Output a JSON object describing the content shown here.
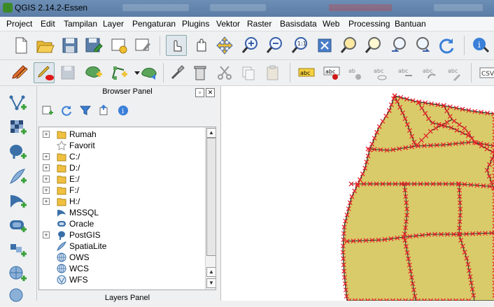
{
  "window": {
    "title": "QGIS 2.14.2-Essen"
  },
  "menu": [
    "Project",
    "Edit",
    "Tampilan",
    "Layer",
    "Pengaturan",
    "Plugins",
    "Vektor",
    "Raster",
    "Basisdata",
    "Web",
    "Processing",
    "Bantuan"
  ],
  "browser_panel": {
    "title": "Browser Panel",
    "items": [
      {
        "label": "Rumah",
        "icon": "folder-icon",
        "expandable": true
      },
      {
        "label": "Favorit",
        "icon": "star-icon",
        "expandable": false
      },
      {
        "label": "C:/",
        "icon": "folder-icon",
        "expandable": true
      },
      {
        "label": "D:/",
        "icon": "folder-icon",
        "expandable": true
      },
      {
        "label": "E:/",
        "icon": "folder-icon",
        "expandable": true
      },
      {
        "label": "F:/",
        "icon": "folder-icon",
        "expandable": true
      },
      {
        "label": "H:/",
        "icon": "folder-icon",
        "expandable": true
      },
      {
        "label": "MSSQL",
        "icon": "mssql-icon",
        "expandable": false
      },
      {
        "label": "Oracle",
        "icon": "oracle-icon",
        "expandable": false
      },
      {
        "label": "PostGIS",
        "icon": "postgis-icon",
        "expandable": true
      },
      {
        "label": "SpatiaLite",
        "icon": "spatialite-icon",
        "expandable": false
      },
      {
        "label": "OWS",
        "icon": "globe-icon",
        "expandable": false
      },
      {
        "label": "WCS",
        "icon": "globe-icon",
        "expandable": false
      },
      {
        "label": "WFS",
        "icon": "wfs-icon",
        "expandable": false
      }
    ]
  },
  "layers_panel": {
    "title": "Layers Panel"
  },
  "colors": {
    "polygon_fill": "#d9cb6a",
    "vertex": "#e8202a",
    "canvas_bg": "#ffffff"
  }
}
